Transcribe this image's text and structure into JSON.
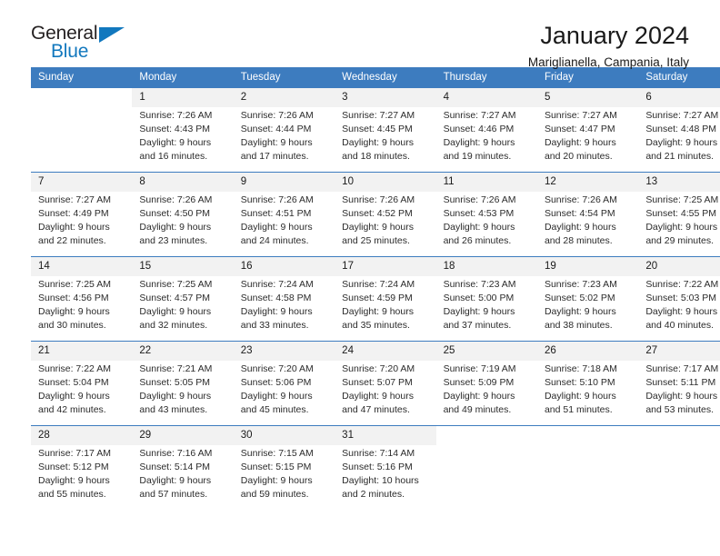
{
  "brand": {
    "name_part1": "General",
    "name_part2": "Blue",
    "accent_color": "#1278be"
  },
  "header": {
    "title": "January 2024",
    "subtitle": "Mariglianella, Campania, Italy",
    "header_bg_color": "#3d7cbf",
    "daynum_bg_color": "#f2f2f2"
  },
  "weekdays": [
    "Sunday",
    "Monday",
    "Tuesday",
    "Wednesday",
    "Thursday",
    "Friday",
    "Saturday"
  ],
  "weeks": [
    {
      "days": [
        {
          "num": "",
          "sunrise": "",
          "sunset": "",
          "daylight1": "",
          "daylight2": ""
        },
        {
          "num": "1",
          "sunrise": "Sunrise: 7:26 AM",
          "sunset": "Sunset: 4:43 PM",
          "daylight1": "Daylight: 9 hours",
          "daylight2": "and 16 minutes."
        },
        {
          "num": "2",
          "sunrise": "Sunrise: 7:26 AM",
          "sunset": "Sunset: 4:44 PM",
          "daylight1": "Daylight: 9 hours",
          "daylight2": "and 17 minutes."
        },
        {
          "num": "3",
          "sunrise": "Sunrise: 7:27 AM",
          "sunset": "Sunset: 4:45 PM",
          "daylight1": "Daylight: 9 hours",
          "daylight2": "and 18 minutes."
        },
        {
          "num": "4",
          "sunrise": "Sunrise: 7:27 AM",
          "sunset": "Sunset: 4:46 PM",
          "daylight1": "Daylight: 9 hours",
          "daylight2": "and 19 minutes."
        },
        {
          "num": "5",
          "sunrise": "Sunrise: 7:27 AM",
          "sunset": "Sunset: 4:47 PM",
          "daylight1": "Daylight: 9 hours",
          "daylight2": "and 20 minutes."
        },
        {
          "num": "6",
          "sunrise": "Sunrise: 7:27 AM",
          "sunset": "Sunset: 4:48 PM",
          "daylight1": "Daylight: 9 hours",
          "daylight2": "and 21 minutes."
        }
      ]
    },
    {
      "days": [
        {
          "num": "7",
          "sunrise": "Sunrise: 7:27 AM",
          "sunset": "Sunset: 4:49 PM",
          "daylight1": "Daylight: 9 hours",
          "daylight2": "and 22 minutes."
        },
        {
          "num": "8",
          "sunrise": "Sunrise: 7:26 AM",
          "sunset": "Sunset: 4:50 PM",
          "daylight1": "Daylight: 9 hours",
          "daylight2": "and 23 minutes."
        },
        {
          "num": "9",
          "sunrise": "Sunrise: 7:26 AM",
          "sunset": "Sunset: 4:51 PM",
          "daylight1": "Daylight: 9 hours",
          "daylight2": "and 24 minutes."
        },
        {
          "num": "10",
          "sunrise": "Sunrise: 7:26 AM",
          "sunset": "Sunset: 4:52 PM",
          "daylight1": "Daylight: 9 hours",
          "daylight2": "and 25 minutes."
        },
        {
          "num": "11",
          "sunrise": "Sunrise: 7:26 AM",
          "sunset": "Sunset: 4:53 PM",
          "daylight1": "Daylight: 9 hours",
          "daylight2": "and 26 minutes."
        },
        {
          "num": "12",
          "sunrise": "Sunrise: 7:26 AM",
          "sunset": "Sunset: 4:54 PM",
          "daylight1": "Daylight: 9 hours",
          "daylight2": "and 28 minutes."
        },
        {
          "num": "13",
          "sunrise": "Sunrise: 7:25 AM",
          "sunset": "Sunset: 4:55 PM",
          "daylight1": "Daylight: 9 hours",
          "daylight2": "and 29 minutes."
        }
      ]
    },
    {
      "days": [
        {
          "num": "14",
          "sunrise": "Sunrise: 7:25 AM",
          "sunset": "Sunset: 4:56 PM",
          "daylight1": "Daylight: 9 hours",
          "daylight2": "and 30 minutes."
        },
        {
          "num": "15",
          "sunrise": "Sunrise: 7:25 AM",
          "sunset": "Sunset: 4:57 PM",
          "daylight1": "Daylight: 9 hours",
          "daylight2": "and 32 minutes."
        },
        {
          "num": "16",
          "sunrise": "Sunrise: 7:24 AM",
          "sunset": "Sunset: 4:58 PM",
          "daylight1": "Daylight: 9 hours",
          "daylight2": "and 33 minutes."
        },
        {
          "num": "17",
          "sunrise": "Sunrise: 7:24 AM",
          "sunset": "Sunset: 4:59 PM",
          "daylight1": "Daylight: 9 hours",
          "daylight2": "and 35 minutes."
        },
        {
          "num": "18",
          "sunrise": "Sunrise: 7:23 AM",
          "sunset": "Sunset: 5:00 PM",
          "daylight1": "Daylight: 9 hours",
          "daylight2": "and 37 minutes."
        },
        {
          "num": "19",
          "sunrise": "Sunrise: 7:23 AM",
          "sunset": "Sunset: 5:02 PM",
          "daylight1": "Daylight: 9 hours",
          "daylight2": "and 38 minutes."
        },
        {
          "num": "20",
          "sunrise": "Sunrise: 7:22 AM",
          "sunset": "Sunset: 5:03 PM",
          "daylight1": "Daylight: 9 hours",
          "daylight2": "and 40 minutes."
        }
      ]
    },
    {
      "days": [
        {
          "num": "21",
          "sunrise": "Sunrise: 7:22 AM",
          "sunset": "Sunset: 5:04 PM",
          "daylight1": "Daylight: 9 hours",
          "daylight2": "and 42 minutes."
        },
        {
          "num": "22",
          "sunrise": "Sunrise: 7:21 AM",
          "sunset": "Sunset: 5:05 PM",
          "daylight1": "Daylight: 9 hours",
          "daylight2": "and 43 minutes."
        },
        {
          "num": "23",
          "sunrise": "Sunrise: 7:20 AM",
          "sunset": "Sunset: 5:06 PM",
          "daylight1": "Daylight: 9 hours",
          "daylight2": "and 45 minutes."
        },
        {
          "num": "24",
          "sunrise": "Sunrise: 7:20 AM",
          "sunset": "Sunset: 5:07 PM",
          "daylight1": "Daylight: 9 hours",
          "daylight2": "and 47 minutes."
        },
        {
          "num": "25",
          "sunrise": "Sunrise: 7:19 AM",
          "sunset": "Sunset: 5:09 PM",
          "daylight1": "Daylight: 9 hours",
          "daylight2": "and 49 minutes."
        },
        {
          "num": "26",
          "sunrise": "Sunrise: 7:18 AM",
          "sunset": "Sunset: 5:10 PM",
          "daylight1": "Daylight: 9 hours",
          "daylight2": "and 51 minutes."
        },
        {
          "num": "27",
          "sunrise": "Sunrise: 7:17 AM",
          "sunset": "Sunset: 5:11 PM",
          "daylight1": "Daylight: 9 hours",
          "daylight2": "and 53 minutes."
        }
      ]
    },
    {
      "days": [
        {
          "num": "28",
          "sunrise": "Sunrise: 7:17 AM",
          "sunset": "Sunset: 5:12 PM",
          "daylight1": "Daylight: 9 hours",
          "daylight2": "and 55 minutes."
        },
        {
          "num": "29",
          "sunrise": "Sunrise: 7:16 AM",
          "sunset": "Sunset: 5:14 PM",
          "daylight1": "Daylight: 9 hours",
          "daylight2": "and 57 minutes."
        },
        {
          "num": "30",
          "sunrise": "Sunrise: 7:15 AM",
          "sunset": "Sunset: 5:15 PM",
          "daylight1": "Daylight: 9 hours",
          "daylight2": "and 59 minutes."
        },
        {
          "num": "31",
          "sunrise": "Sunrise: 7:14 AM",
          "sunset": "Sunset: 5:16 PM",
          "daylight1": "Daylight: 10 hours",
          "daylight2": "and 2 minutes."
        },
        {
          "num": "",
          "sunrise": "",
          "sunset": "",
          "daylight1": "",
          "daylight2": ""
        },
        {
          "num": "",
          "sunrise": "",
          "sunset": "",
          "daylight1": "",
          "daylight2": ""
        },
        {
          "num": "",
          "sunrise": "",
          "sunset": "",
          "daylight1": "",
          "daylight2": ""
        }
      ]
    }
  ]
}
